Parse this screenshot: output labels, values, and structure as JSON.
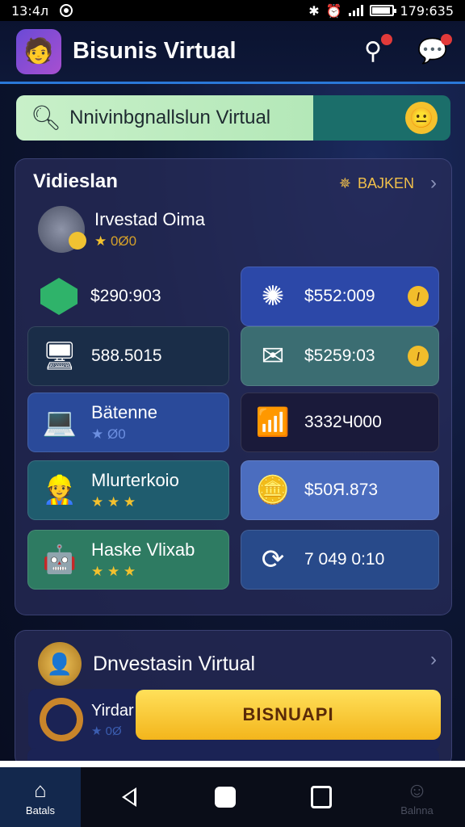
{
  "status_bar": {
    "time": "13:4л",
    "clock_right": "179:635"
  },
  "header": {
    "title": "Bisunis Virtual",
    "avatar": "man-avatar"
  },
  "search": {
    "value": "Nnivinbgnallslun Virtual"
  },
  "panel": {
    "title": "Vidieslan",
    "link_label": "BAJKEN",
    "invest_name": "Irvestad Oima",
    "invest_rating_text": "0Ø0",
    "cards": [
      {
        "icon": "diamond-icon",
        "value": "$290:903",
        "has_coin": false,
        "color": ""
      },
      {
        "icon": "splash-icon",
        "value": "$552:009",
        "has_coin": true,
        "color": "#2c48a8"
      },
      {
        "icon": "monitor-icon",
        "value": "588.5015",
        "has_coin": false,
        "color": ""
      },
      {
        "icon": "mail-icon",
        "value": "$5259:03",
        "has_coin": true,
        "color": "#3b6d72"
      },
      {
        "icon": "laptop-icon",
        "name": "Bätenne",
        "stars_text": "Ø0",
        "color": "#2a4a9a"
      },
      {
        "icon": "chart-icon",
        "value": "3332Ч000",
        "color": "#1a1a3a"
      },
      {
        "icon": "worker-icon",
        "name": "Mlurterkoio",
        "color": "#1f5c6e"
      },
      {
        "icon": "coin-card-icon",
        "value": "$50Я.873",
        "color": "#4b6dbf"
      },
      {
        "icon": "robot-icon",
        "name": "Haske Vlixab",
        "color": "#2e7b62"
      },
      {
        "icon": "refresh-icon",
        "value": "7 049 0:10",
        "color": "#284a8a"
      }
    ]
  },
  "panel2": {
    "title": "Dnvestasin Virtual",
    "row_name": "Yirdar",
    "row_stars": "0Ø",
    "cta_label": "BISNUAPI"
  },
  "nav": {
    "home_label": "Batals",
    "right_label": "Balnna"
  }
}
